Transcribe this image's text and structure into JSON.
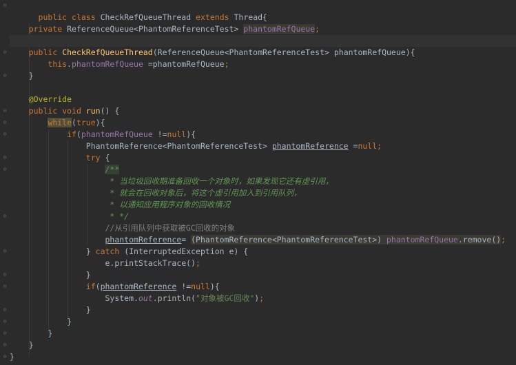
{
  "code": {
    "l1": {
      "kw1": "public",
      "kw2": "class",
      "name": "CheckRefQueueThread",
      "kw3": "extends",
      "sup": "Thread{"
    },
    "l3": {
      "kw": "private",
      "type": "ReferenceQueue<PhantomReferenceTest>",
      "field": "phantomRefQueue",
      "semi": ";"
    },
    "l5": {
      "kw": "public",
      "ctor": "CheckRefQueueThread",
      "params": "(ReferenceQueue<PhantomReferenceTest> phantomRefQueue){"
    },
    "l6": {
      "kw": "this",
      "dot": ".",
      "field": "phantomRefQueue",
      "rest": " =phantomRefQueue",
      "semi": ";"
    },
    "l7": "}",
    "l9": "@Override",
    "l10": {
      "kw1": "public",
      "kw2": "void",
      "fn": "run",
      "rest": "() {"
    },
    "l11": {
      "kw1": "while",
      "open": "(",
      "kw2": "true",
      "close": "){"
    },
    "l12": {
      "kw": "if",
      "open": "(",
      "field": "phantomRefQueue",
      "op": " !=",
      "kw2": "null",
      "close": "){"
    },
    "l13": {
      "type": "PhantomReference<PhantomReferenceTest> ",
      "var": "phantomReference",
      "op": " =",
      "kw": "null",
      "semi": ";"
    },
    "l14": {
      "kw": "try",
      "rest": " {"
    },
    "l15": "/**",
    "l16": " * 当垃圾回收期准备回收一个对象时，如果发现它还有虚引用，",
    "l17": " * 就会在回收对象后，将这个虚引用加入到引用队列，",
    "l18": " * 以通知应用程序对象的回收情况",
    "l19": " * */",
    "l20": "//从引用队列中获取被GC回收的对象",
    "l21": {
      "var": "phantomReference",
      "op": "= ",
      "cast": "(PhantomReference<PhantomReferenceTest>) ",
      "field": "phantomRefQueue",
      "call": ".remove()",
      "semi": ";"
    },
    "l22": {
      "brace": "} ",
      "kw": "catch",
      "rest": " (InterruptedException e) {"
    },
    "l23": {
      "obj": "e.printStackTrace()",
      "semi": ";"
    },
    "l24": "}",
    "l25": {
      "kw": "if",
      "open": "(",
      "var": "phantomReference",
      "op": " !=",
      "kw2": "null",
      "close": "){"
    },
    "l26": {
      "cls": "System.",
      "out": "out",
      "mid": ".println(",
      "str": "\"对象被GC回收\"",
      "close": ")",
      "semi": ";"
    },
    "l27": "}",
    "l28": "}",
    "l29": "}",
    "l30": "}",
    "l31": "}"
  },
  "colors": {
    "background": "#2b2b2b",
    "keyword": "#cc7832",
    "method": "#ffc66d",
    "field": "#9876aa",
    "annotation": "#bbb529",
    "string": "#6a8759",
    "doc_comment": "#629755",
    "comment": "#808080"
  }
}
